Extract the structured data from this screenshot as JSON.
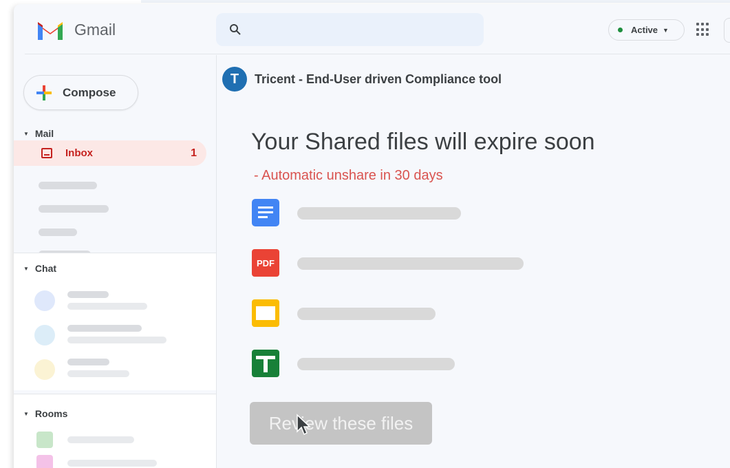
{
  "app": {
    "name": "Gmail",
    "status_label": "Active",
    "accent": "#c5221f"
  },
  "search": {
    "icon": "search-icon"
  },
  "sidebar": {
    "compose_label": "Compose",
    "mail_section": "Mail",
    "inbox": {
      "label": "Inbox",
      "count": "1"
    },
    "chat_section": "Chat",
    "rooms_section": "Rooms"
  },
  "message": {
    "sender_initial": "T",
    "sender_name": "Tricent - End-User driven Compliance tool",
    "subject": "Your Shared files will expire soon",
    "subtitle": "- Automatic unshare in 30 days",
    "files": [
      {
        "icon": "google-docs-icon",
        "color": "#4285f4"
      },
      {
        "icon": "pdf-icon",
        "color": "#ea4335",
        "icon_text": "PDF"
      },
      {
        "icon": "google-slides-icon",
        "color": "#fbbc04"
      },
      {
        "icon": "google-sheets-icon",
        "color": "#188038"
      }
    ],
    "review_button": "Review these files"
  }
}
